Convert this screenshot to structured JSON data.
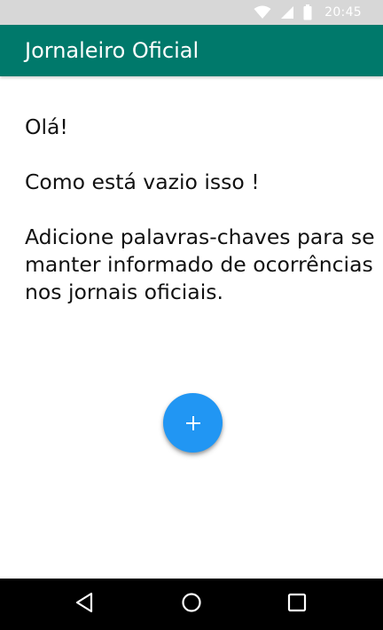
{
  "status_bar": {
    "time": "20:45",
    "icons": [
      "wifi-icon",
      "signal-icon",
      "battery-icon"
    ]
  },
  "app_bar": {
    "title": "Jornaleiro Oficial",
    "color": "#00796b"
  },
  "content": {
    "greeting": "Olá!",
    "empty_message": "Como está vazio isso !",
    "instructions": "Adicione palavras-chaves para se manter informado de ocorrências nos jornais oficiais."
  },
  "fab": {
    "icon": "plus-icon",
    "color": "#2196f3"
  },
  "navigation_bar": {
    "buttons": [
      "back-icon",
      "home-icon",
      "recents-icon"
    ]
  }
}
